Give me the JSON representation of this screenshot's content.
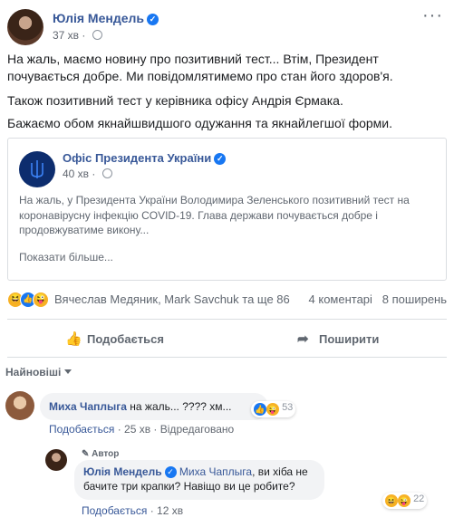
{
  "post": {
    "author": "Юлія Мендель",
    "time": "37 хв",
    "paragraphs": [
      "На жаль, маємо новину про позитивний тест... Втім, Президент почувається добре. Ми повідомлятимемо про стан його здоров'я.",
      "Також позитивний тест у керівника офісу Андрія Єрмака.",
      "Бажаємо обом якнайшвидшого одужання та якнайлегшої форми."
    ]
  },
  "shared": {
    "author": "Офіс Президента України",
    "time": "40 хв",
    "text": "На жаль, у Президента України Володимира Зеленського позитивний тест на коронавірусну інфекцію COVID-19. Глава держави почувається добре і продовжуватиме викону...",
    "see_more": "Показати більше..."
  },
  "reactions": {
    "names": "Вячеслав Медяник, Mark Savchuk та ще 86",
    "comments": "4 коментарі",
    "shares": "8 поширень"
  },
  "actions": {
    "like": "Подобається",
    "share": "Поширити"
  },
  "sort": "Найновіші",
  "comments": [
    {
      "name": "Миха Чаплыга",
      "text": "на жаль... ???? хм...",
      "reaction_count": "53",
      "like": "Подобається",
      "time": "25 хв",
      "reply": "Відредаговано"
    },
    {
      "author_tag": "Автор",
      "name": "Юлія Мендель",
      "mention": "Миха Чаплыга",
      "text": ", ви хіба не бачите три крапки? Навіщо ви це робите?",
      "reaction_count": "22",
      "like": "Подобається",
      "time": "12 хв"
    }
  ],
  "colors": {
    "link": "#385898",
    "accent": "#1877f2",
    "muted": "#606770"
  },
  "icons": [
    "globe-icon",
    "more-icon",
    "like-icon",
    "share-icon",
    "verified-icon",
    "pen-icon"
  ]
}
